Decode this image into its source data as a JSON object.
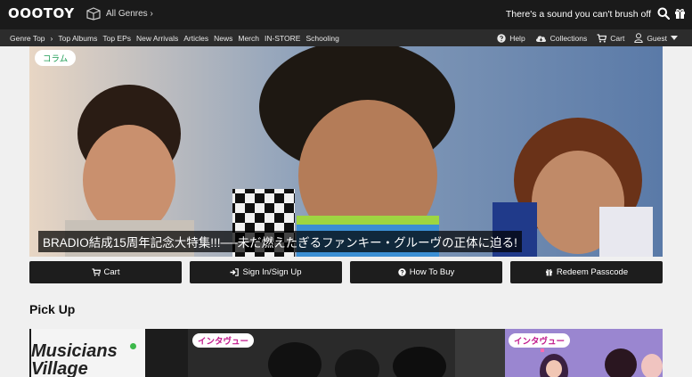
{
  "header": {
    "logo": "OOOTOY",
    "genres_label": "All Genres ›",
    "slogan": "There's a sound you can't brush off",
    "icons": [
      "search-icon",
      "gift-icon"
    ]
  },
  "nav": {
    "links": [
      "Genre Top",
      "›",
      "Top Albums",
      "Top EPs",
      "New Arrivals",
      "Articles",
      "News",
      "Merch",
      "IN-STORE",
      "Schooling"
    ],
    "help": "Help",
    "collections": "Collections",
    "cart": "Cart",
    "guest": "Guest"
  },
  "hero": {
    "tag": "コラム",
    "caption": "BRADIO結成15周年記念大特集!!!──未だ燃えたぎるファンキー・グルーヴの正体に迫る!"
  },
  "buttons": {
    "cart": "Cart",
    "signin": "Sign In/Sign Up",
    "howto": "How To Buy",
    "redeem": "Redeem Passcode"
  },
  "pickup": {
    "title": "Pick Up",
    "card1_text": "Musicians Village",
    "card2_tag": "インタヴュー",
    "card3_tag": "インタヴュー"
  },
  "colors": {
    "header_bg": "#1a1a1a",
    "nav_bg": "#2c2c2c",
    "page_bg": "#f0f0f0",
    "column_tag_text": "#1f9d55",
    "interview_tag_text": "#c1188b"
  }
}
